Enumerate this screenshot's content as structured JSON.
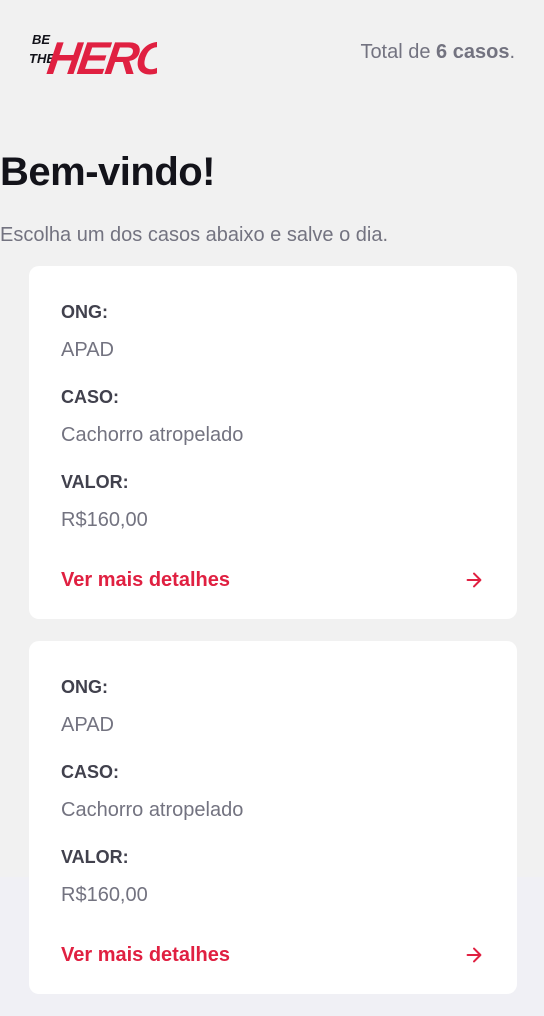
{
  "header": {
    "logo_alt": "BE THE HERO",
    "total_prefix": "Total de ",
    "total_count": "6 casos",
    "total_suffix": "."
  },
  "main": {
    "title": "Bem-vindo!",
    "subtitle": "Escolha um dos casos abaixo e salve o dia."
  },
  "labels": {
    "ong": "ONG:",
    "caso": "CASO:",
    "valor": "VALOR:",
    "details": "Ver mais detalhes"
  },
  "incidents": [
    {
      "ong": "APAD",
      "caso": "Cachorro atropelado",
      "valor": "R$160,00"
    },
    {
      "ong": "APAD",
      "caso": "Cachorro atropelado",
      "valor": "R$160,00"
    }
  ],
  "colors": {
    "brand": "#e02041",
    "background": "#f1f1f1",
    "title": "#13131a",
    "text_muted": "#737380",
    "label": "#41414d"
  },
  "icons": {
    "details_arrow": "arrow-right-icon"
  }
}
